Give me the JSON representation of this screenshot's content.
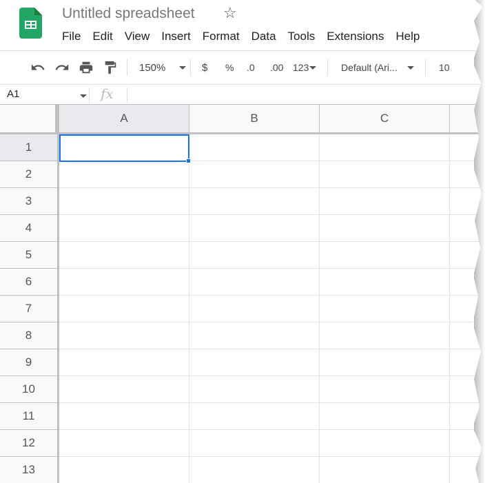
{
  "app": {
    "title": "Untitled spreadsheet",
    "brand_color": "#23a566"
  },
  "menu": [
    "File",
    "Edit",
    "View",
    "Insert",
    "Format",
    "Data",
    "Tools",
    "Extensions",
    "Help"
  ],
  "toolbar": {
    "zoom": "150%",
    "currency": "$",
    "percent": "%",
    "decrease_decimal": ".0",
    "increase_decimal": ".00",
    "more_formats": "123",
    "font": "Default (Ari...",
    "font_size": "10"
  },
  "formula_bar": {
    "name_box": "A1",
    "fx": "fx",
    "value": ""
  },
  "grid": {
    "columns": [
      "A",
      "B",
      "C",
      ""
    ],
    "rows": [
      "1",
      "2",
      "3",
      "4",
      "5",
      "6",
      "7",
      "8",
      "9",
      "10",
      "11",
      "12",
      "13"
    ],
    "selected_cell": "A1",
    "selection_color": "#1a73e8"
  }
}
